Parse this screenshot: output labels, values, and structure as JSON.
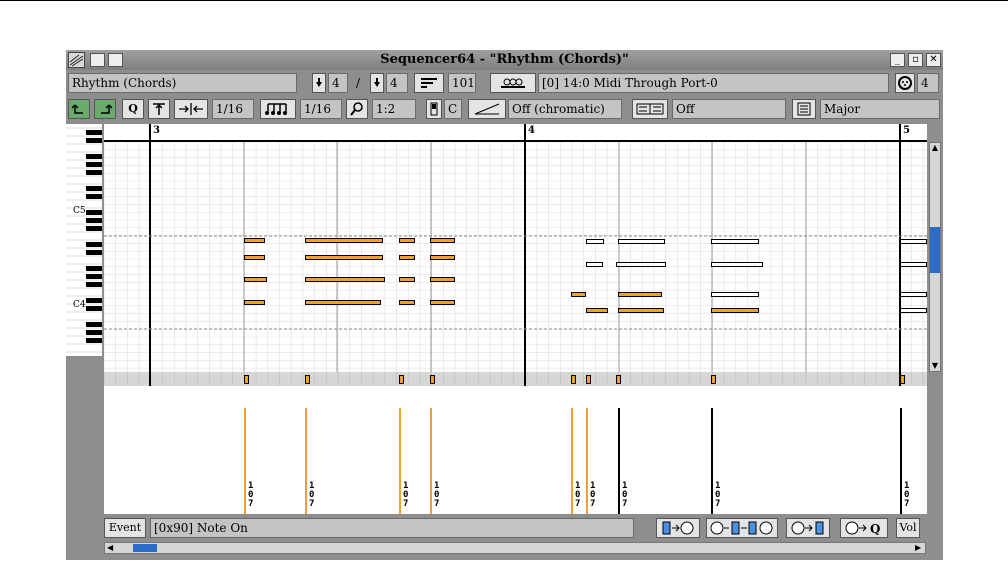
{
  "window": {
    "title": "Sequencer64 - \"Rhythm (Chords)\""
  },
  "toolbar1": {
    "pattern_name": "Rhythm (Chords)",
    "beats_per_bar": "4",
    "separator": "/",
    "beat_width": "4",
    "measures": "101",
    "midi_bus": "[0] 14:0 Midi Through Port-0",
    "midi_channel": "4"
  },
  "toolbar2": {
    "snap": "1/16",
    "note_length": "1/16",
    "zoom": "1:2",
    "key": "C",
    "scale_mode": "Off (chromatic)",
    "background_sequence": "Off",
    "chord": "Major"
  },
  "ruler": {
    "measures": [
      "3",
      "4",
      "5"
    ]
  },
  "piano": {
    "labels": [
      "C5",
      "C4"
    ]
  },
  "velocities": [
    "107",
    "107",
    "107",
    "107",
    "107",
    "107",
    "107",
    "107",
    "107"
  ],
  "bottom": {
    "event_button": "Event",
    "event_type": "[0x90] Note On",
    "vol_button": "Vol"
  },
  "colors": {
    "note_fill": "#f0a030",
    "selected_note": "#ffffff",
    "window_bg": "#8e8e8e"
  },
  "icons": [
    "undo-icon",
    "redo-icon",
    "quantize-icon",
    "tighten-icon",
    "expand-icon",
    "note-length-icon",
    "zoom-icon",
    "key-icon",
    "scale-icon",
    "background-sequence-icon",
    "chord-icon",
    "midi-bus-icon",
    "midi-channel-icon",
    "bpm-icon"
  ]
}
